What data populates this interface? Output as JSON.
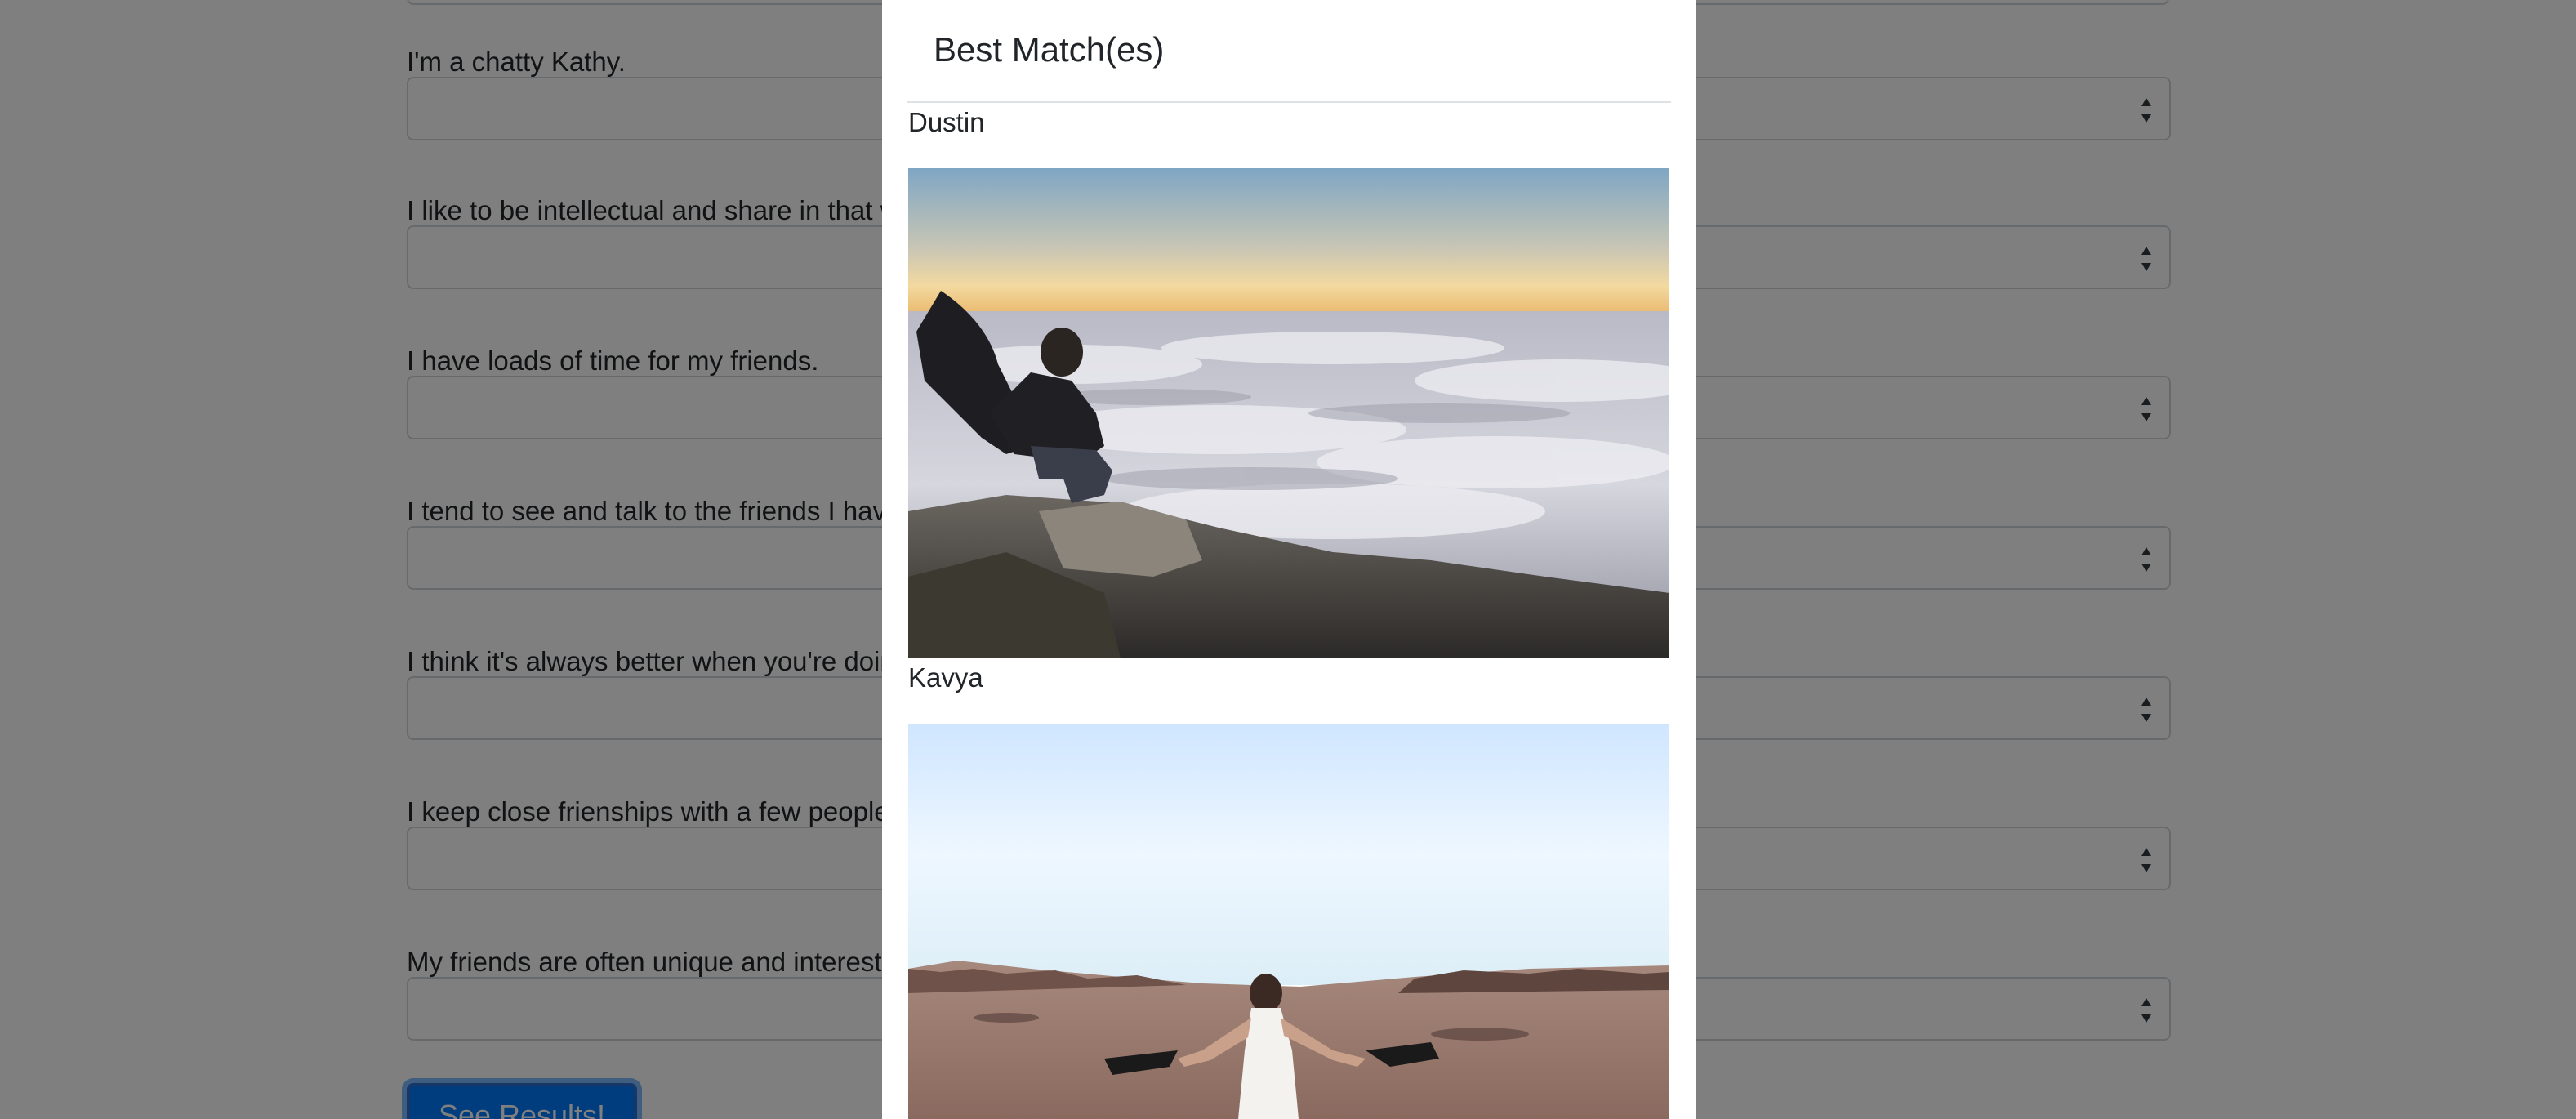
{
  "survey": {
    "questions": [
      {
        "label": "I'm a chatty Kathy.",
        "value": ""
      },
      {
        "label": "I like to be intellectual and share in that way with my friends.",
        "value": ""
      },
      {
        "label": "I have loads of time for my friends.",
        "value": ""
      },
      {
        "label": "I tend to see and talk to the friends I have often.",
        "value": ""
      },
      {
        "label": "I think it's always better when you're doing things together.",
        "value": ""
      },
      {
        "label": "I keep close frienships with a few people.",
        "value": ""
      },
      {
        "label": "My friends are often unique and interesting.",
        "value": ""
      }
    ],
    "submit_label": "See Results!"
  },
  "modal": {
    "title": "Best Match(es)",
    "matches": [
      {
        "name": "Dustin",
        "photo": "person sitting on a cliff above a sea of clouds at sunrise"
      },
      {
        "name": "Kavya",
        "photo": "woman in a white dress dancing in a desert with black fans"
      }
    ]
  },
  "colors": {
    "overlay": "rgba(0,0,0,0.5)",
    "primary_button": "#007bff",
    "select_border": "#ced4da"
  }
}
